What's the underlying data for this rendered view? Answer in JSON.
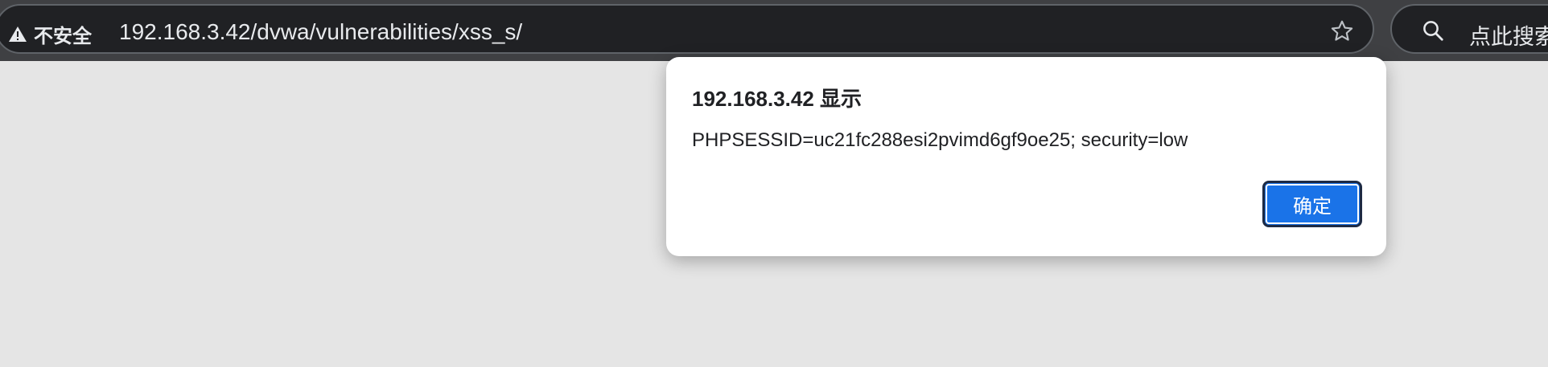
{
  "browser": {
    "security_label": "不安全",
    "url": "192.168.3.42/dvwa/vulnerabilities/xss_s/",
    "search_placeholder": "点此搜索"
  },
  "alert": {
    "title": "192.168.3.42 显示",
    "message": "PHPSESSID=uc21fc288esi2pvimd6gf9oe25; security=low",
    "ok_label": "确定"
  },
  "colors": {
    "toolbar_bg": "#3f4043",
    "omnibox_bg": "#202124",
    "page_bg": "#e5e5e5",
    "button_blue": "#1a73e8"
  },
  "icons": [
    "warning-icon",
    "star-icon",
    "search-icon"
  ]
}
